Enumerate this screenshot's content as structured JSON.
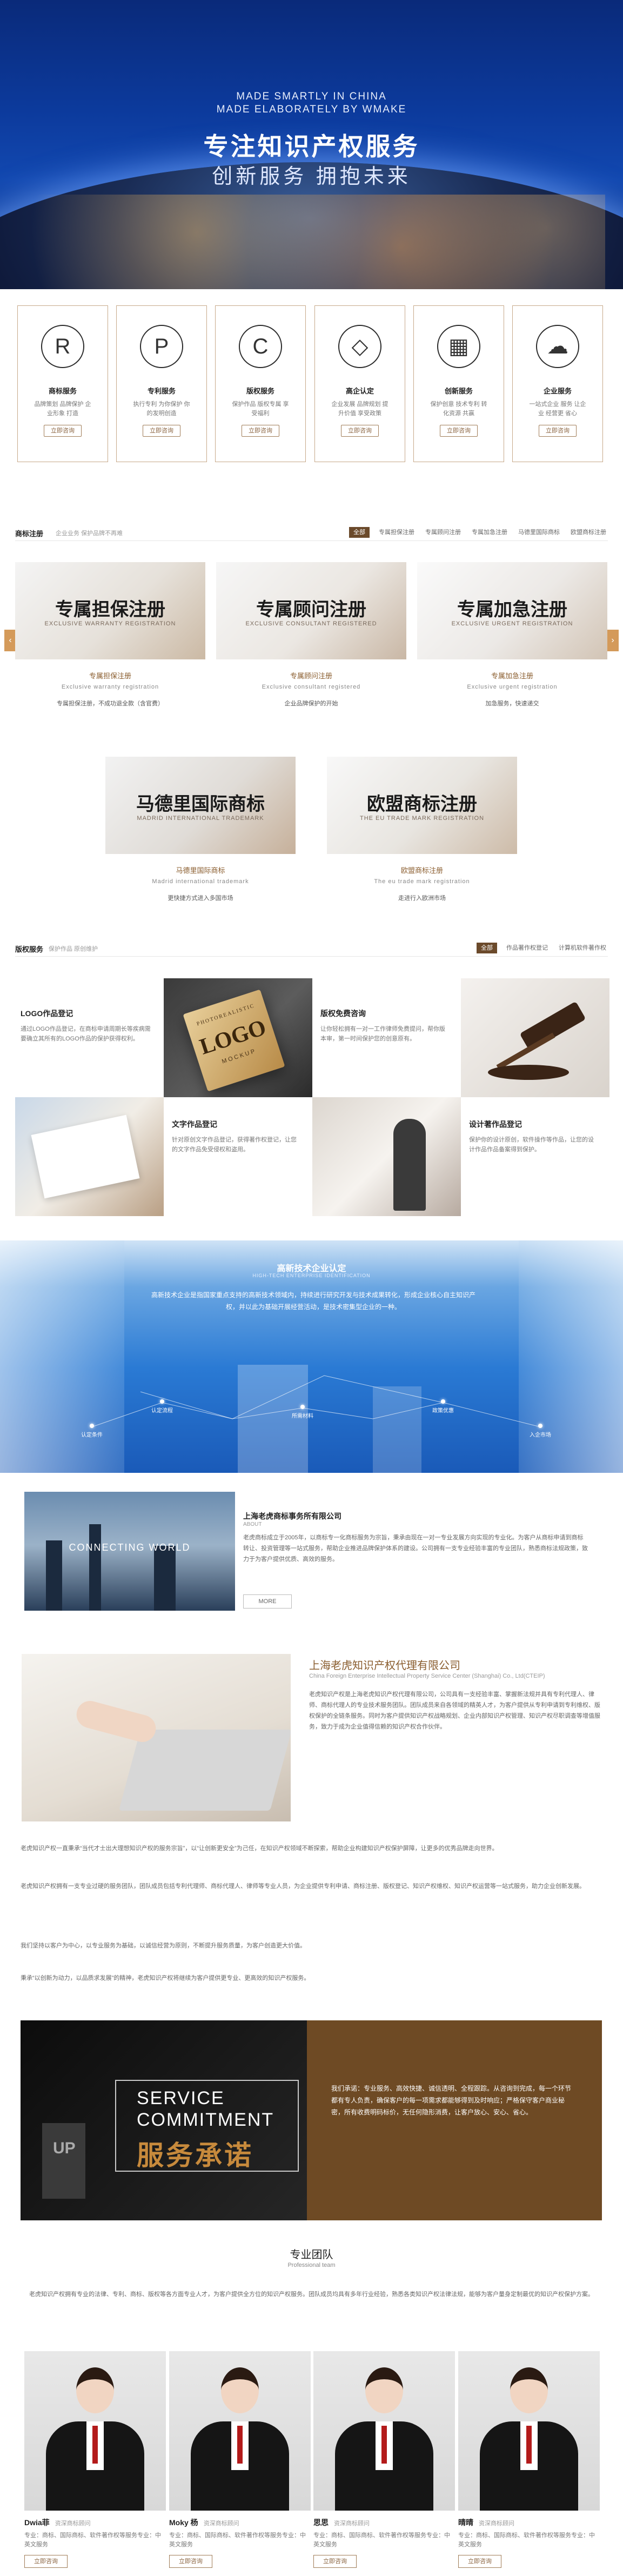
{
  "hero": {
    "en_line1": "MADE SMARTLY IN CHINA",
    "en_line2": "MADE ELABORATELY BY WMAKE",
    "title": "专注知识产权服务",
    "subtitle": "创新服务  拥抱未来"
  },
  "services": [
    {
      "name": "商标服务",
      "desc": "品牌策划 品牌保护 企业形象 打造",
      "icon": "registered-icon",
      "glyph": "R",
      "btn": "立即咨询"
    },
    {
      "name": "专利服务",
      "desc": "执行专利 为你保护 你的发明创造",
      "icon": "patent-icon",
      "glyph": "P",
      "btn": "立即咨询"
    },
    {
      "name": "版权服务",
      "desc": "保护作品 版权专属 享受福利 ",
      "icon": "copyright-icon",
      "glyph": "C",
      "btn": "立即咨询"
    },
    {
      "name": "高企认定",
      "desc": "企业发展 品牌规划 提升价值 享受政策",
      "icon": "diamond-icon",
      "glyph": "◇",
      "btn": "立即咨询"
    },
    {
      "name": "创新服务",
      "desc": "保护创意 技术专利 转化资源 共赢",
      "icon": "grid-icon",
      "glyph": "▦",
      "btn": "立即咨询"
    },
    {
      "name": "企业服务",
      "desc": "一站式企业 服务 让企业 经营更 省心",
      "icon": "cloud-icon",
      "glyph": "☁",
      "btn": "立即咨询"
    }
  ],
  "trademark": {
    "title": "商标注册",
    "subtitle": "企业业务  保护品牌不再难",
    "tabs": [
      "全部",
      "专属担保注册",
      "专属顾问注册",
      "专属加急注册",
      "马德里国际商标",
      "欧盟商标注册"
    ],
    "cards": [
      {
        "big": "专属担保注册",
        "en": "EXCLUSIVE WARRANTY REGISTRATION",
        "name": "专属担保注册",
        "desc": "Exclusive warranty registration",
        "note": "专属担保注册，不成功退全款（含官费）"
      },
      {
        "big": "专属顾问注册",
        "en": "EXCLUSIVE CONSULTANT REGISTERED",
        "name": "专属顾问注册",
        "desc": "Exclusive consultant registered",
        "note": "企业品牌保护的开始"
      },
      {
        "big": "专属加急注册",
        "en": "EXCLUSIVE URGENT REGISTRATION",
        "name": "专属加急注册",
        "desc": "Exclusive urgent registration",
        "note": "加急服务，快速递交"
      },
      {
        "big": "马德里国际商标",
        "en": "MADRID INTERNATIONAL TRADEMARK",
        "name": "马德里国际商标",
        "desc": "Madrid international trademark",
        "note": "更快捷方式进入多国市场"
      },
      {
        "big": "欧盟商标注册",
        "en": "THE EU TRADE MARK REGISTRATION",
        "name": "欧盟商标注册",
        "desc": "The eu trade mark registration",
        "note": "走进行入欧洲市场"
      }
    ]
  },
  "copyright": {
    "title": "版权服务",
    "subtitle": "保护作品  原创维护",
    "tabs": [
      "全部",
      "作品著作权登记",
      "计算机软件著作权"
    ],
    "items": [
      {
        "title": "LOGO作品登记",
        "desc": "通过LOGO作品登记，在商标申请周期长等疾病需要确立其所有的LOGO作品的保护获得权利。"
      },
      {
        "title": "版权免费咨询",
        "desc": "让你轻松拥有一对一工作律师免费提问，帮你版本审，第一时间保护您的创意原有。"
      },
      {
        "title": "文字作品登记",
        "desc": "针对原创文字作品登记，获得著作权登记，让您的文字作品免受侵权和盗用。"
      },
      {
        "title": "设计著作品登记",
        "desc": "保护你的设计原创，软件操作等作品，让您的设计作品作品备案得到保护。"
      }
    ],
    "logo_mock": "LOGO",
    "logo_arc": "PHOTOREALISTIC",
    "logo_sub": "MOCKUP"
  },
  "hitech": {
    "title": "高新技术企业认定",
    "subtitle": "HIGH-TECH ENTERPRISE IDENTIFICATION",
    "desc": "高新技术企业是指国家重点支持的高新技术领域内，持续进行研究开发与技术成果转化，形成企业核心自主知识产权，并以此为基础开展经营活动，是技术密集型企业的一种。",
    "nodes": [
      "认定条件",
      "认定流程",
      "所需材料",
      "政策优惠",
      "入企市场"
    ]
  },
  "about1": {
    "title": "上海老虎商标事务所有限公司",
    "en": "ABOUT",
    "text": "老虎商标成立于2005年，以商标专一化商标服务为宗旨，秉承由现在一对一专业发展方向实现的专业化。为客户从商标申请到商标转让、投资管理等一站式服务，帮助企业推进品牌保护体系的建设。公司拥有一支专业经验丰富的专业团队，熟悉商标法规政策，致力于为客户提供优质、高效的服务。",
    "banner": "CONNECTING WORLD",
    "more": "MORE"
  },
  "about2": {
    "title": "上海老虎知识产权代理有限公司",
    "en": "China Foreign Enterprise Intellectual Property Service Center (Shanghai) Co., Ltd(CTEIP)",
    "text": "老虎知识产权是上海老虎知识产权代理有限公司，公司具有一支经验丰富、掌握新法规并具有专利代理人、律师、商标代理人的专业技术服务团队。团队成员来自各领域的精英人才，为客户提供从专利申请到专利维权、版权保护的全链条服务。同时为客户提供知识产权战略规划、企业内部知识产权管理、知识产权尽职调查等增值服务，致力于成为企业值得信赖的知识产权合作伙伴。",
    "para1": "老虎知识产权一直秉承“当代才士出大理想知识产权的服务宗旨”，以“让创新更安全”为己任，在知识产权领域不断探索，帮助企业构建知识产权保护屏障，让更多的优秀品牌走向世界。",
    "para2": "老虎知识产权拥有一支专业过硬的服务团队，团队成员包括专利代理师、商标代理人、律师等专业人员，为企业提供专利申请、商标注册、版权登记、知识产权维权、知识产权运营等一站式服务，助力企业创新发展。",
    "para3": "我们坚持以客户为中心，以专业服务为基础，以诚信经营为原则，不断提升服务质量，为客户创造更大价值。",
    "para4": "秉承“以创新为动力，以品质求发展”的精神，老虎知识产权将继续为客户提供更专业、更高效的知识产权服务。"
  },
  "commitment": {
    "line1": "SERVICE",
    "line2": "COMMITMENT",
    "cn": "服务承诺",
    "sign": "UP",
    "text": "我们承诺：专业服务、高效快捷、诚信透明、全程跟踪。从咨询到完成，每一个环节都有专人负责，确保客户的每一项需求都能够得到及时响应；严格保守客户商业秘密，所有收费明码标价，无任何隐形消费，让客户放心、安心、省心。"
  },
  "team": {
    "title": "专业团队",
    "en": "Professional team",
    "intro": "老虎知识产权拥有专业的法律、专利、商标、版权等各方面专业人才，为客户提供全方位的知识产权服务。团队成员均具有多年行业经验，熟悉各类知识产权法律法规，能够为客户量身定制最优的知识产权保护方案。",
    "members": [
      {
        "name": "Dwia菲",
        "role": "资深商标顾问",
        "desc": "专业：商标、国际商标、软件著作权等服务专业：中英文服务",
        "btn": "立即咨询"
      },
      {
        "name": "Moky 杨",
        "role": "资深商标顾问",
        "desc": "专业：商标、国际商标、软件著作权等服务专业：中英文服务",
        "btn": "立即咨询"
      },
      {
        "name": "思思",
        "role": "资深商标顾问",
        "desc": "专业：商标、国际商标、软件著作权等服务专业：中英文服务",
        "btn": "立即咨询"
      },
      {
        "name": "晴晴",
        "role": "资深商标顾问",
        "desc": "专业：商标、国际商标、软件著作权等服务专业：中英文服务",
        "btn": "立即咨询"
      }
    ]
  }
}
